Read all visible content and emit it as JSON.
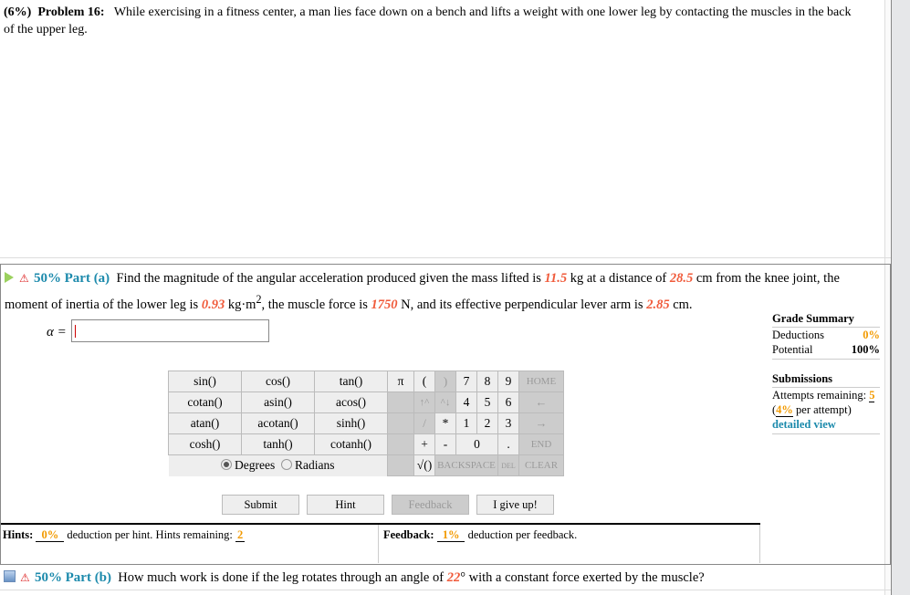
{
  "problem": {
    "weight": "(6%)",
    "number": "Problem 16:",
    "text": "While exercising in a fitness center, a man lies face down on a bench and lifts a weight with one lower leg by contacting the muscles in the back of the upper leg."
  },
  "part_a": {
    "percent": "50%",
    "label": "Part (a)",
    "t1": "Find the magnitude of the angular acceleration produced given the mass lifted is ",
    "v1": "11.5",
    "t2": " kg at a distance of ",
    "v2": "28.5",
    "t3": " cm from the knee joint, the moment of inertia of the lower leg is ",
    "v3": "0.93",
    "t4": " kg·m",
    "t4sup": "2",
    "t5": ", the muscle force is ",
    "v4": "1750",
    "t6": " N, and its effective perpendicular lever arm is ",
    "v5": "2.85",
    "t7": " cm.",
    "answer_label": "α =",
    "answer_value": ""
  },
  "grade_summary": {
    "title": "Grade Summary",
    "deductions_label": "Deductions",
    "deductions_value": "0%",
    "potential_label": "Potential",
    "potential_value": "100%"
  },
  "submissions": {
    "title": "Submissions",
    "attempts_label": "Attempts remaining:",
    "attempts_value": "5",
    "per_attempt_open": "(",
    "per_attempt_value": "4%",
    "per_attempt_text": " per attempt)",
    "detailed_view": "detailed view"
  },
  "calculator": {
    "functions": [
      [
        "sin()",
        "cos()",
        "tan()"
      ],
      [
        "cotan()",
        "asin()",
        "acos()"
      ],
      [
        "atan()",
        "acotan()",
        "sinh()"
      ],
      [
        "cosh()",
        "tanh()",
        "cotanh()"
      ]
    ],
    "degrees": "Degrees",
    "radians": "Radians",
    "angle_mode": "Degrees",
    "keys": {
      "pi": "π",
      "lparen": "(",
      "rparen": ")",
      "k7": "7",
      "k8": "8",
      "k9": "9",
      "home": "HOME",
      "up": "↑^",
      "down": "^↓",
      "k4": "4",
      "k5": "5",
      "k6": "6",
      "left": "←",
      "div": "/",
      "mul": "*",
      "k1": "1",
      "k2": "2",
      "k3": "3",
      "right": "→",
      "plus": "+",
      "minus": "-",
      "k0": "0",
      "dot": ".",
      "end": "END",
      "sqrt": "√()",
      "backspace": "BACKSPACE",
      "del": "DEL",
      "clear": "CLEAR"
    }
  },
  "buttons": {
    "submit": "Submit",
    "hint": "Hint",
    "feedback": "Feedback",
    "give_up": "I give up!"
  },
  "hints": {
    "label": "Hints:",
    "deduction": "0%",
    "text": " deduction per hint. Hints remaining: ",
    "remaining": "2"
  },
  "feedback": {
    "label": "Feedback:",
    "deduction": "1%",
    "text": " deduction per feedback."
  },
  "part_b": {
    "percent": "50%",
    "label": "Part (b)",
    "t1": "How much work is done if the leg rotates through an angle of ",
    "v1": "22",
    "t2": "° with a constant force exerted by the muscle?"
  },
  "colors": {
    "accent": "#1c8aac",
    "given_value": "#f05a3a",
    "orange": "#f29a00"
  }
}
